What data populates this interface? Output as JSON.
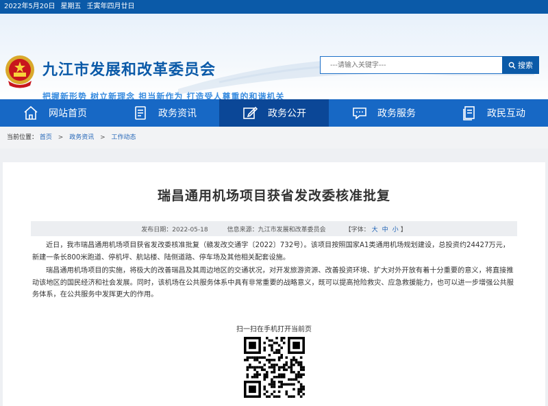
{
  "topbar": {
    "date": "2022年5月20日",
    "weekday": "星期五",
    "lunar": "壬寅年四月廿日"
  },
  "header": {
    "title": "九江市发展和改革委员会",
    "slogan": "把握新形势 树立新理念 担当新作为 打造受人尊重的和谐机关",
    "search_placeholder": "---请输入关键字---",
    "search_label": "搜索"
  },
  "nav": [
    {
      "label": "网站首页",
      "icon": "home-icon"
    },
    {
      "label": "政务资讯",
      "icon": "document-icon"
    },
    {
      "label": "政务公开",
      "icon": "edit-icon"
    },
    {
      "label": "政务服务",
      "icon": "chat-icon"
    },
    {
      "label": "政民互动",
      "icon": "file-list-icon"
    }
  ],
  "breadcrumb": {
    "prefix": "当前位置：",
    "items": [
      "首页",
      "政务资讯",
      "工作动态"
    ]
  },
  "article": {
    "title": "瑞昌通用机场项目获省发改委核准批复",
    "date": "发布日期：2022-05-18",
    "source": "信息来源：九江市发展和改革委员会",
    "font_prefix": "【字体：",
    "font_large": "大",
    "font_medium": "中",
    "font_small": "小",
    "font_suffix": "】",
    "paragraphs": [
      "近日，我市瑞昌通用机场项目获省发改委核准批复（赣发改交通字〔2022〕732号）。该项目按照国家A1类通用机场规划建设，总投资约24427万元，新建一条长800米跑道、停机坪、航站楼、陆侧道路、停车场及其他相关配套设施。",
      "瑞昌通用机场项目的实施，将极大的改善瑞昌及其周边地区的交通状况，对开发旅游资源、改善投资环境、扩大对外开放有着十分重要的意义，将直接推动该地区的国民经济和社会发展。同时，该机场在公共服务体系中具有非常重要的战略意义，既可以提高抢险救灾、应急救援能力，也可以进一步增强公共服务体系，在公共服务中发挥更大的作用。"
    ],
    "qr_label": "扫一扫在手机打开当前页"
  },
  "colors": {
    "brand": "#0b5aa8",
    "nav": "#1768c5",
    "nav_active": "#0b4797"
  }
}
